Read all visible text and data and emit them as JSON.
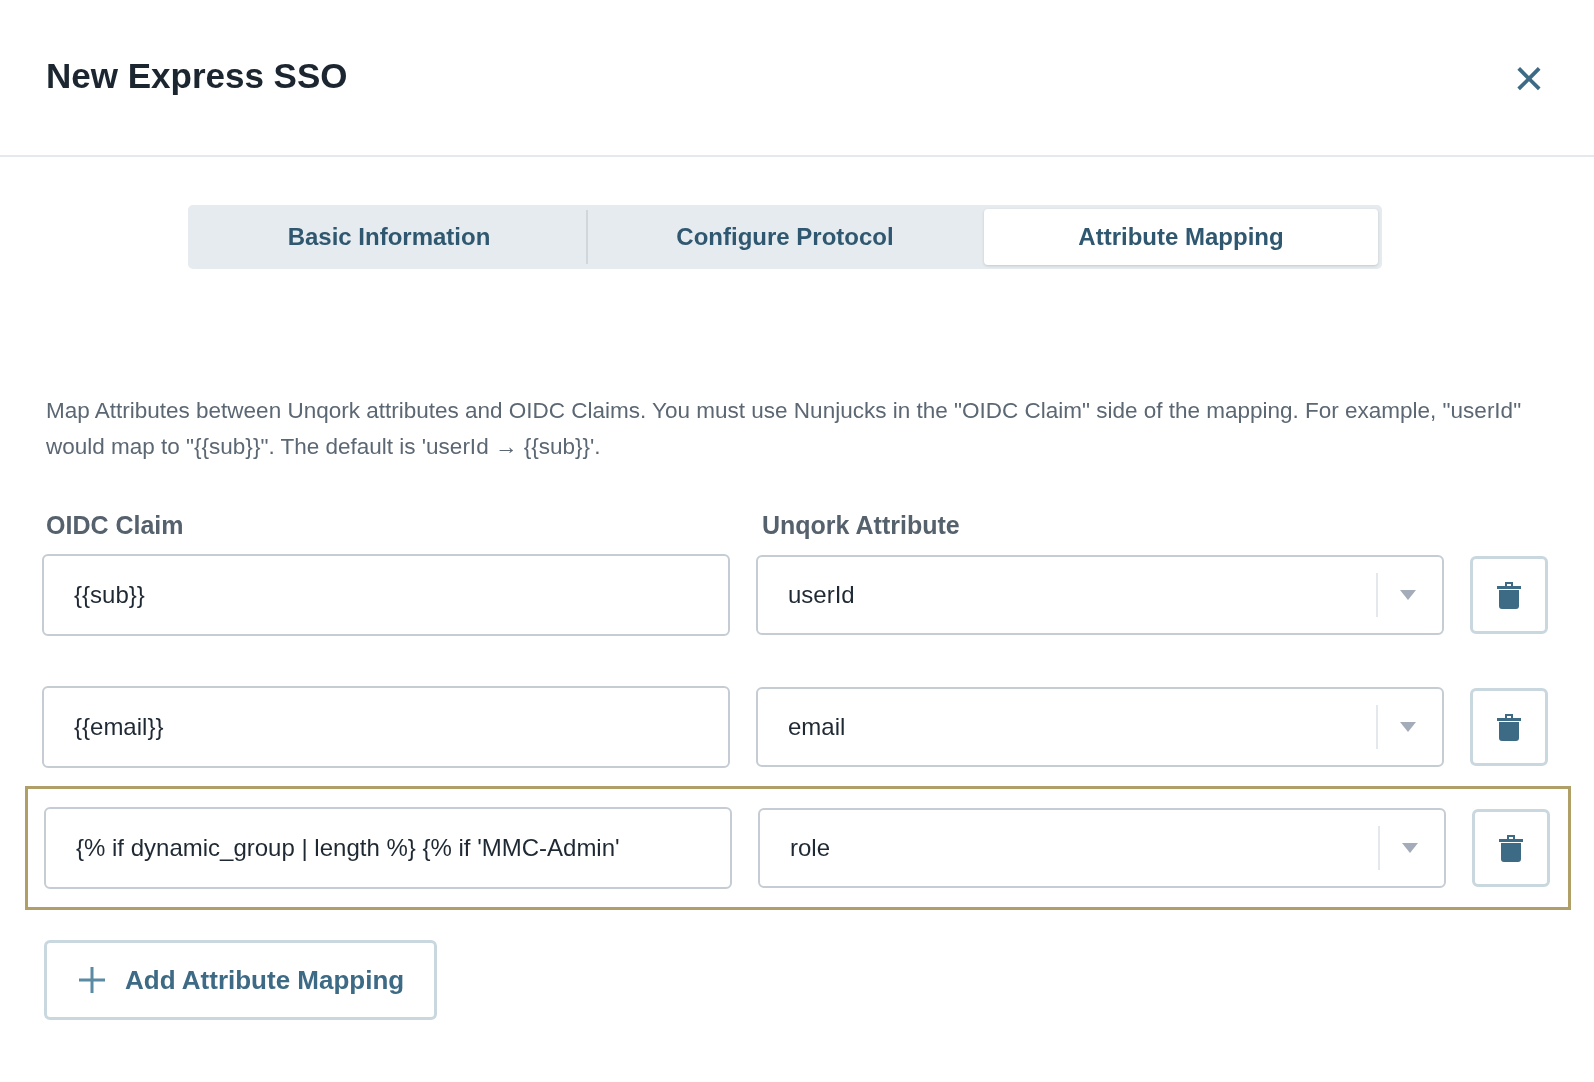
{
  "dialog": {
    "title": "New Express SSO",
    "close_icon": "×"
  },
  "tabs": [
    {
      "label": "Basic Information",
      "selected": false
    },
    {
      "label": "Configure Protocol",
      "selected": false
    },
    {
      "label": "Attribute Mapping",
      "selected": true
    }
  ],
  "description": "Map Attributes between Unqork attributes and OIDC Claims. You must use Nunjucks in the \"OIDC Claim\" side of the mapping. For example, \"userId\" would map to \"{{sub}}\". The default is 'userId → {{sub}}'.",
  "columns": [
    "OIDC Claim",
    "Unqork Attribute"
  ],
  "mappings": [
    {
      "claim": "{{sub}}",
      "attribute": "userId",
      "highlighted": false
    },
    {
      "claim": "{{email}}",
      "attribute": "email",
      "highlighted": false
    },
    {
      "claim": "{% if dynamic_group | length %} {% if 'MMC-Admin'",
      "attribute": "role",
      "highlighted": true
    }
  ],
  "add_button": {
    "label": "Add Attribute Mapping"
  }
}
